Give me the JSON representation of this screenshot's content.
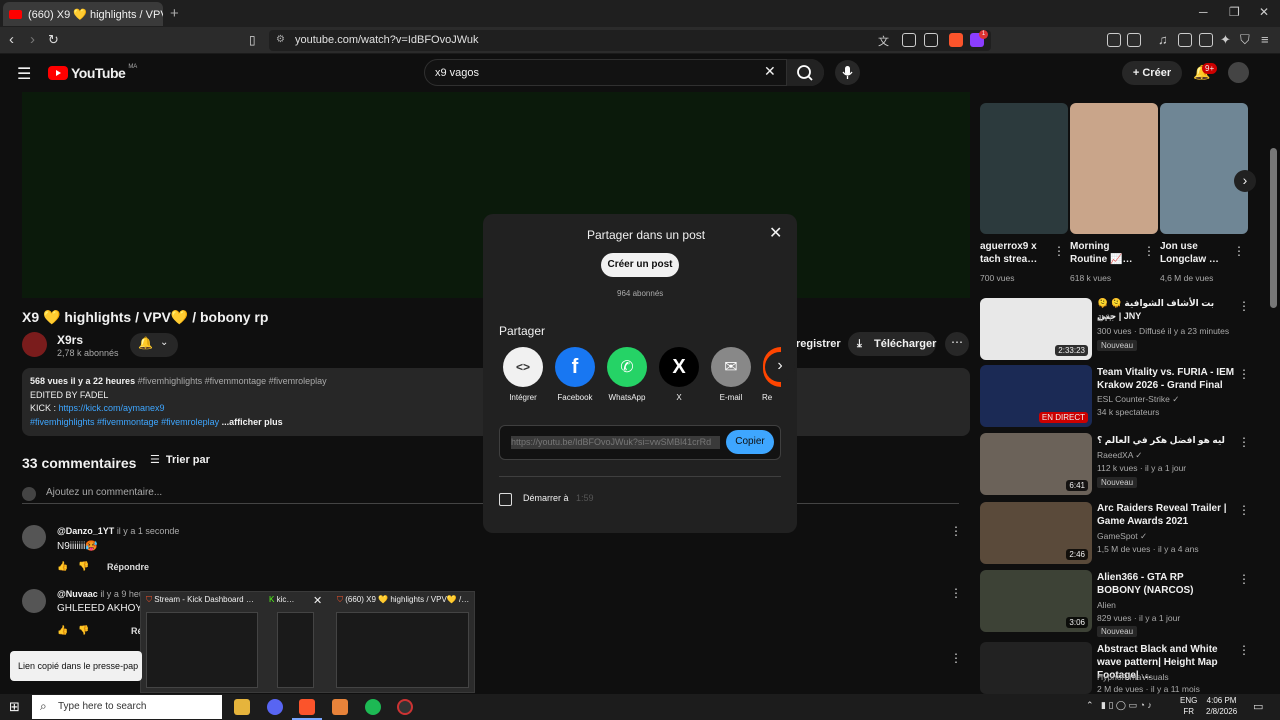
{
  "browser": {
    "tab_title": "(660) X9 💛 highlights / VPV💛",
    "new_tab": "+",
    "url": "youtube.com/watch?v=IdBFOvoJWuk",
    "window": {
      "minimize": "─",
      "maximize": "❐",
      "close": "✕"
    },
    "ext_badge": "1"
  },
  "youtube": {
    "logo_text": "YouTube",
    "logo_region": "MA",
    "search_value": "x9 vagos",
    "create_label": "Créer",
    "notif_count": "9+"
  },
  "video": {
    "title": "X9 💛 highlights / VPV💛 / bobony rp",
    "channel": "X9rs",
    "subscribers": "2,78 k abonnés",
    "save_label": "registrer",
    "download_label": "Télécharger",
    "desc": {
      "stats": "568 vues  il y a 22 heures",
      "tags1": "#fivemhighlights #fivemmontage #fivemroleplay",
      "line2": "EDITED BY FADEL",
      "kick_label": "KICK : ",
      "kick_link": "https://kick.com/aymanex9",
      "tags2": "#fivemhighlights #fivemmontage #fivemroleplay",
      "more": " ...afficher plus"
    }
  },
  "comments": {
    "count": "33 commentaires",
    "sort": "Trier par",
    "add_placeholder": "Ajoutez un commentaire...",
    "items": [
      {
        "author": "@Danzo_1YT",
        "time": "il y a 1 seconde",
        "text": "N9iiiiiii🥵",
        "reply": "Répondre"
      },
      {
        "author": "@Nuvaac",
        "time": "il y a 9 heures",
        "text": "GHLEEED AKHOYA 🔥",
        "reply": "Ré"
      }
    ]
  },
  "share": {
    "title": "Partager dans un post",
    "create_post": "Créer un post",
    "subs": "964 abonnés",
    "section": "Partager",
    "options": [
      {
        "label": "Intégrer",
        "icon": "embed-icon",
        "color": "#f1f1f1"
      },
      {
        "label": "Facebook",
        "icon": "facebook-icon",
        "color": "#1877f2"
      },
      {
        "label": "WhatsApp",
        "icon": "whatsapp-icon",
        "color": "#25d366"
      },
      {
        "label": "X",
        "icon": "x-icon",
        "color": "#000000"
      },
      {
        "label": "E-mail",
        "icon": "email-icon",
        "color": "#888888"
      },
      {
        "label": "Re",
        "icon": "reddit-icon",
        "color": "#ff4500"
      }
    ],
    "link": "https://youtu.be/IdBFOvoJWuk?si=vwSMBl41crRd",
    "copy": "Copier",
    "start_at": "Démarrer à",
    "start_time": "1:59"
  },
  "sidebar": {
    "shorts": [
      {
        "title": "aguerrox9 x tach strea…",
        "views": "700 vues"
      },
      {
        "title": "Morning Routine 📈…",
        "views": "618 k vues"
      },
      {
        "title": "Jon use Longclaw …",
        "views": "4,6 M de vues"
      }
    ],
    "videos": [
      {
        "title": "🫠 بت الأشاف الشوافية 🫠 جني | JNY",
        "channel": "JNY",
        "meta": "300 vues · Diffusé il y a 23 minutes",
        "badge": "Nouveau",
        "duration": "2:33:23"
      },
      {
        "title": "Team Vitality vs. FURIA - IEM Krakow 2026 - Grand Final",
        "channel": "ESL Counter-Strike ✓",
        "meta": "34 k spectateurs",
        "badge": "",
        "duration": "EN DIRECT"
      },
      {
        "title": "ليه هو افضل هكر في العالم ؟",
        "channel": "RaeedXA ✓",
        "meta": "112 k vues · il y a 1 jour",
        "badge": "Nouveau",
        "duration": "6:41"
      },
      {
        "title": "Arc Raiders Reveal Trailer | Game Awards 2021",
        "channel": "GameSpot ✓",
        "meta": "1,5 M de vues · il y a 4 ans",
        "badge": "",
        "duration": "2:46"
      },
      {
        "title": "Alien366 - GTA RP BOBONY (NARCOS)",
        "channel": "Alien",
        "meta": "829 vues · il y a 1 jour",
        "badge": "Nouveau",
        "duration": "3:06"
      },
      {
        "title": "Abstract Black and White wave pattern| Height Map Footage| …",
        "channel": "HypnoRimaVisuals",
        "meta": "2 M de vues · il y a 11 mois",
        "badge": "",
        "duration": ""
      }
    ]
  },
  "taskbar": {
    "previews": [
      {
        "title": "Stream - Kick Dashboard …"
      },
      {
        "title": "kic…"
      },
      {
        "title": "(660) X9 💛 highlights / VPV💛 /…"
      }
    ],
    "toast": "Lien copié dans le presse-pap",
    "search_placeholder": "Type here to search",
    "lang1": "ENG",
    "lang2": "FR",
    "time": "4:06 PM",
    "date": "2/8/2026"
  }
}
